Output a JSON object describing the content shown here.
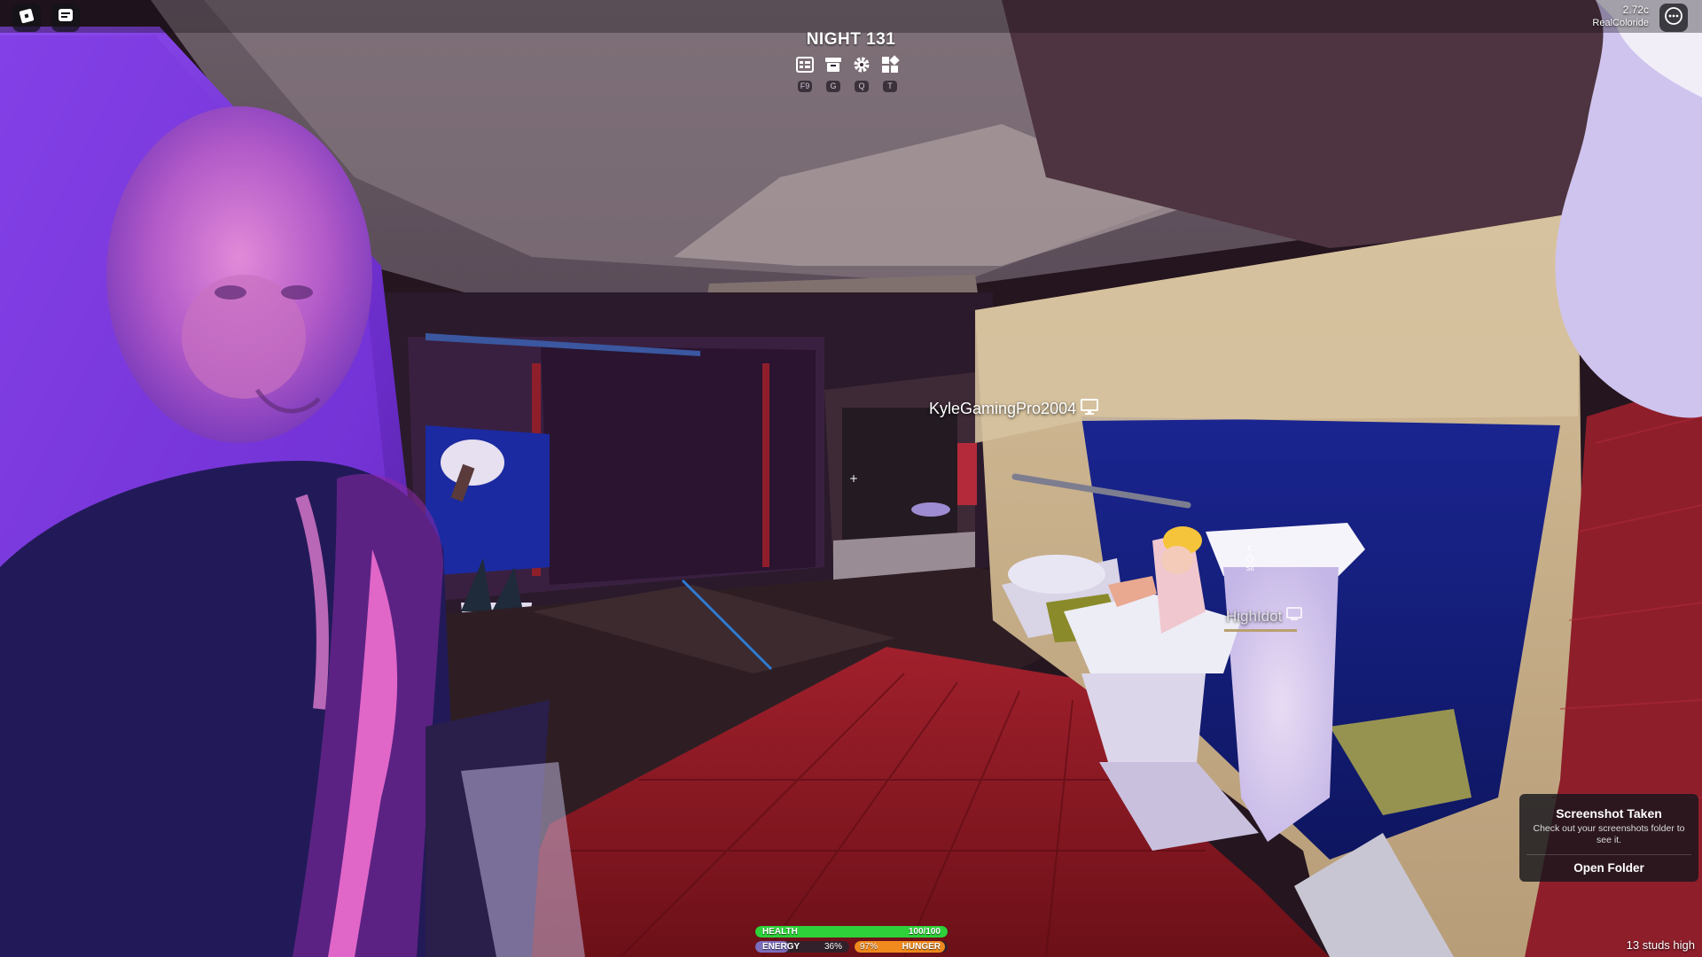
{
  "topbar": {
    "roblox_menu_icon": "roblox-logo-icon",
    "chat_icon": "chat-bubble-icon",
    "more_icon": "ellipsis-icon",
    "ping_text": "2.72c",
    "username": "RealColoride"
  },
  "hud": {
    "title": "NIGHT 131",
    "tools": [
      {
        "name": "leaderboard",
        "icon": "leaderboard-icon",
        "hotkey": "F9"
      },
      {
        "name": "store",
        "icon": "shop-icon",
        "hotkey": "G"
      },
      {
        "name": "settings",
        "icon": "gear-icon",
        "hotkey": "Q"
      },
      {
        "name": "menu",
        "icon": "grid-icon",
        "hotkey": "T"
      }
    ]
  },
  "players": {
    "player_one": "KyleGamingPro2004",
    "player_two": "HighIdot",
    "device_icon": "monitor-icon"
  },
  "interact_prompt": {
    "top": "E",
    "bottom": "Sit"
  },
  "stats": {
    "health": {
      "label": "HEALTH",
      "value": "100/100",
      "fraction": 1.0,
      "color": "#2fd13a"
    },
    "energy": {
      "label": "ENERGY",
      "value": "36%",
      "fraction": 0.36,
      "color": "#8a7bd6"
    },
    "hunger": {
      "label": "HUNGER",
      "value": "97%",
      "fraction": 0.97,
      "color": "#f08a1e"
    }
  },
  "toast": {
    "title": "Screenshot Taken",
    "body": "Check out your screenshots folder to see it.",
    "button": "Open Folder"
  },
  "footer": {
    "height_readout": "13 studs high"
  },
  "colors": {
    "carpet": "#8a1a24",
    "wall_purple": "#7a38d8",
    "wood": "#c9b08a",
    "blue_panel": "#16207a"
  }
}
